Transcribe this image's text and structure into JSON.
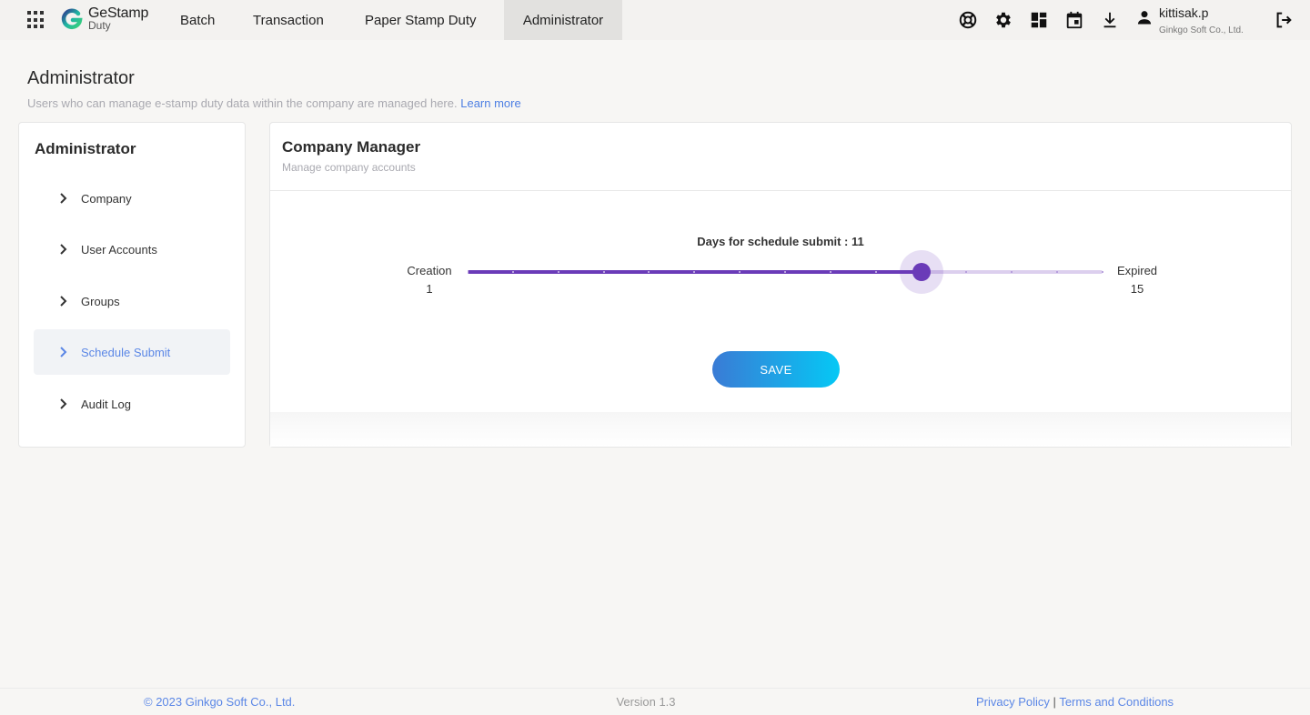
{
  "app": {
    "logo_name": "GeStamp",
    "logo_sub": "Duty"
  },
  "nav": {
    "tabs": [
      {
        "label": "Batch"
      },
      {
        "label": "Transaction"
      },
      {
        "label": "Paper Stamp Duty"
      },
      {
        "label": "Administrator",
        "active": true
      }
    ]
  },
  "header_icons": [
    "support-icon",
    "settings-icon",
    "dashboard-icon",
    "calendar-icon",
    "download-icon",
    "logout-icon"
  ],
  "user": {
    "name": "kittisak.p",
    "org": "Ginkgo Soft Co., Ltd."
  },
  "page": {
    "title": "Administrator",
    "description": "Users who can manage e-stamp duty data within the company are managed here.",
    "learn_more": "Learn more"
  },
  "sidebar": {
    "title": "Administrator",
    "items": [
      {
        "label": "Company"
      },
      {
        "label": "User Accounts"
      },
      {
        "label": "Groups"
      },
      {
        "label": "Schedule Submit",
        "active": true
      },
      {
        "label": "Audit Log"
      }
    ]
  },
  "card": {
    "title": "Company Manager",
    "subtitle": "Manage company accounts"
  },
  "slider": {
    "caption": "Days for schedule submit : 11",
    "min_label": "Creation",
    "min_value": "1",
    "max_label": "Expired",
    "max_value": "15",
    "min": 1,
    "max": 15,
    "value": 11
  },
  "save_label": "SAVE",
  "footer": {
    "copyright": "© 2023 Ginkgo Soft Co., Ltd.",
    "version": "Version 1.3",
    "privacy": "Privacy Policy",
    "separator": "|",
    "terms": "Terms and Conditions"
  },
  "colors": {
    "accent": "#6a3bb8",
    "link": "#5b87e6",
    "button_start": "#3a7bd5",
    "button_end": "#05c8f5"
  }
}
